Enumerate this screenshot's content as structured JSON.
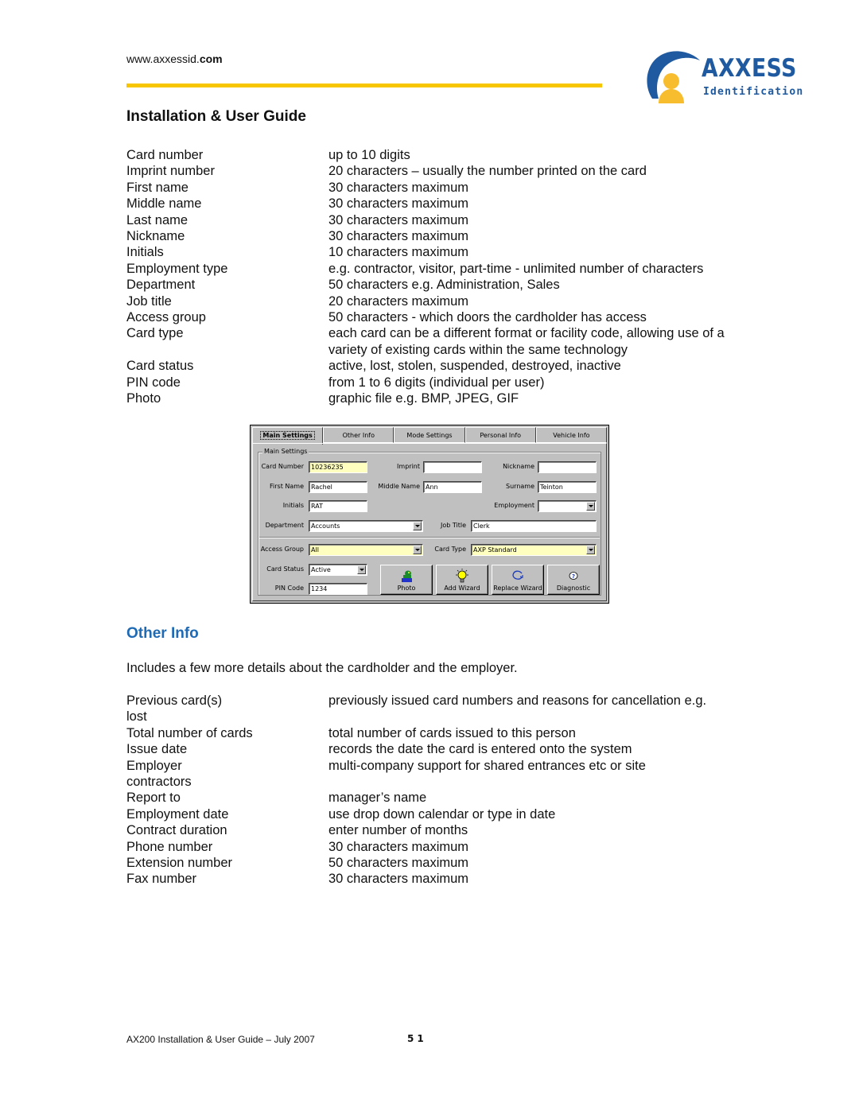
{
  "header": {
    "url_prefix": "www.axxessid.",
    "url_bold": "com",
    "logo": {
      "word": "AXXESS",
      "sub": "Identification",
      "brand_color": "#1f5aa0",
      "person_color": "#f7bd2e"
    },
    "rule_color": "#f7c600"
  },
  "title": "Installation & User Guide",
  "main_settings_fields": [
    {
      "term": "Card number",
      "desc": "up to 10 digits"
    },
    {
      "term": "Imprint number",
      "desc": "20 characters – usually the number printed on the card"
    },
    {
      "term": "First name",
      "desc": "30 characters maximum"
    },
    {
      "term": "Middle name",
      "desc": "30 characters maximum"
    },
    {
      "term": "Last name",
      "desc": "30 characters maximum"
    },
    {
      "term": "Nickname",
      "desc": "30 characters maximum"
    },
    {
      "term": "Initials",
      "desc": "10 characters maximum"
    },
    {
      "term": "Employment type",
      "desc": "e.g. contractor, visitor, part-time - unlimited number of characters"
    },
    {
      "term": "Department",
      "desc": "50 characters e.g. Administration, Sales"
    },
    {
      "term": "Job title",
      "desc": "20 characters maximum"
    },
    {
      "term": "Access group",
      "desc": "50 characters - which doors the cardholder has access"
    },
    {
      "term": "Card type",
      "desc": "each card can be a different format or facility code, allowing use of a variety of existing cards within the same technology"
    },
    {
      "term": "Card status",
      "desc": "active, lost, stolen, suspended, destroyed, inactive"
    },
    {
      "term": "PIN code",
      "desc": "from 1 to 6 digits (individual per user)"
    },
    {
      "term": "Photo",
      "desc": "graphic file e.g. BMP, JPEG, GIF"
    }
  ],
  "dialog": {
    "tabs": [
      {
        "label": "Main Settings",
        "active": true
      },
      {
        "label": "Other Info",
        "active": false
      },
      {
        "label": "Mode Settings",
        "active": false
      },
      {
        "label": "Personal Info",
        "active": false
      },
      {
        "label": "Vehicle Info",
        "active": false
      }
    ],
    "group_label": "Main Settings",
    "fields": {
      "card_number": {
        "label": "Card Number",
        "value": "10236235"
      },
      "imprint": {
        "label": "Imprint",
        "value": ""
      },
      "nickname": {
        "label": "Nickname",
        "value": ""
      },
      "first_name": {
        "label": "First Name",
        "value": "Rachel"
      },
      "middle_name": {
        "label": "Middle Name",
        "value": "Ann"
      },
      "surname": {
        "label": "Surname",
        "value": "Teinton"
      },
      "initials": {
        "label": "Initials",
        "value": "RAT"
      },
      "employment": {
        "label": "Employment",
        "value": ""
      },
      "department": {
        "label": "Department",
        "value": "Accounts"
      },
      "job_title": {
        "label": "Job Title",
        "value": "Clerk"
      },
      "access_group": {
        "label": "Access Group",
        "value": "All"
      },
      "card_type": {
        "label": "Card Type",
        "value": "AXP Standard"
      },
      "card_status": {
        "label": "Card Status",
        "value": "Active"
      },
      "pin_code": {
        "label": "PIN Code",
        "value": "1234"
      }
    },
    "buttons": {
      "photo": "Photo",
      "add_wizard": "Add Wizard",
      "replace_wizard": "Replace Wizard",
      "diagnostic": "Diagnostic"
    },
    "highlight_color": "#ffffc0"
  },
  "other_info": {
    "heading": "Other Info",
    "heading_color": "#1f6ab4",
    "intro": "Includes a few more details about the cardholder and the employer.",
    "fields": [
      {
        "term": "Previous card(s)",
        "desc": "previously issued card numbers and reasons for cancellation e.g.",
        "overflow": "lost"
      },
      {
        "term": "Total number of cards",
        "desc": "total number of cards issued to this person"
      },
      {
        "term": "Issue date",
        "desc": "records the date the card is entered onto the system"
      },
      {
        "term": "Employer",
        "desc": "multi-company support for shared entrances etc or site",
        "overflow": "contractors"
      },
      {
        "term": "Report to",
        "desc": "manager’s name"
      },
      {
        "term": "Employment date",
        "desc": "use drop down calendar or type in date"
      },
      {
        "term": "Contract duration",
        "desc": "enter number of months"
      },
      {
        "term": "Phone number",
        "desc": "30 characters maximum"
      },
      {
        "term": "Extension number",
        "desc": "50 characters maximum"
      },
      {
        "term": "Fax number",
        "desc": "30 characters maximum"
      }
    ]
  },
  "footer": {
    "text": "AX200 Installation & User Guide – July 2007",
    "page_number": "51"
  }
}
